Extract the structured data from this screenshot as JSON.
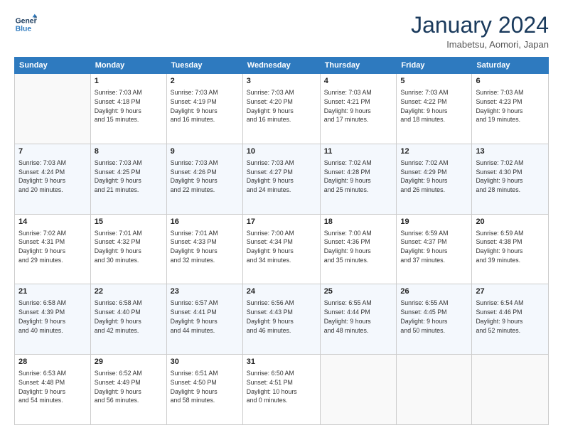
{
  "header": {
    "logo_line1": "General",
    "logo_line2": "Blue",
    "title": "January 2024",
    "subtitle": "Imabetsu, Aomori, Japan"
  },
  "weekdays": [
    "Sunday",
    "Monday",
    "Tuesday",
    "Wednesday",
    "Thursday",
    "Friday",
    "Saturday"
  ],
  "weeks": [
    [
      {
        "day": "",
        "info": ""
      },
      {
        "day": "1",
        "info": "Sunrise: 7:03 AM\nSunset: 4:18 PM\nDaylight: 9 hours\nand 15 minutes."
      },
      {
        "day": "2",
        "info": "Sunrise: 7:03 AM\nSunset: 4:19 PM\nDaylight: 9 hours\nand 16 minutes."
      },
      {
        "day": "3",
        "info": "Sunrise: 7:03 AM\nSunset: 4:20 PM\nDaylight: 9 hours\nand 16 minutes."
      },
      {
        "day": "4",
        "info": "Sunrise: 7:03 AM\nSunset: 4:21 PM\nDaylight: 9 hours\nand 17 minutes."
      },
      {
        "day": "5",
        "info": "Sunrise: 7:03 AM\nSunset: 4:22 PM\nDaylight: 9 hours\nand 18 minutes."
      },
      {
        "day": "6",
        "info": "Sunrise: 7:03 AM\nSunset: 4:23 PM\nDaylight: 9 hours\nand 19 minutes."
      }
    ],
    [
      {
        "day": "7",
        "info": ""
      },
      {
        "day": "8",
        "info": "Sunrise: 7:03 AM\nSunset: 4:25 PM\nDaylight: 9 hours\nand 21 minutes."
      },
      {
        "day": "9",
        "info": "Sunrise: 7:03 AM\nSunset: 4:26 PM\nDaylight: 9 hours\nand 22 minutes."
      },
      {
        "day": "10",
        "info": "Sunrise: 7:03 AM\nSunset: 4:27 PM\nDaylight: 9 hours\nand 24 minutes."
      },
      {
        "day": "11",
        "info": "Sunrise: 7:02 AM\nSunset: 4:28 PM\nDaylight: 9 hours\nand 25 minutes."
      },
      {
        "day": "12",
        "info": "Sunrise: 7:02 AM\nSunset: 4:29 PM\nDaylight: 9 hours\nand 26 minutes."
      },
      {
        "day": "13",
        "info": "Sunrise: 7:02 AM\nSunset: 4:30 PM\nDaylight: 9 hours\nand 28 minutes."
      }
    ],
    [
      {
        "day": "14",
        "info": ""
      },
      {
        "day": "15",
        "info": "Sunrise: 7:01 AM\nSunset: 4:32 PM\nDaylight: 9 hours\nand 30 minutes."
      },
      {
        "day": "16",
        "info": "Sunrise: 7:01 AM\nSunset: 4:33 PM\nDaylight: 9 hours\nand 32 minutes."
      },
      {
        "day": "17",
        "info": "Sunrise: 7:00 AM\nSunset: 4:34 PM\nDaylight: 9 hours\nand 34 minutes."
      },
      {
        "day": "18",
        "info": "Sunrise: 7:00 AM\nSunset: 4:36 PM\nDaylight: 9 hours\nand 35 minutes."
      },
      {
        "day": "19",
        "info": "Sunrise: 6:59 AM\nSunset: 4:37 PM\nDaylight: 9 hours\nand 37 minutes."
      },
      {
        "day": "20",
        "info": "Sunrise: 6:59 AM\nSunset: 4:38 PM\nDaylight: 9 hours\nand 39 minutes."
      }
    ],
    [
      {
        "day": "21",
        "info": ""
      },
      {
        "day": "22",
        "info": "Sunrise: 6:58 AM\nSunset: 4:40 PM\nDaylight: 9 hours\nand 42 minutes."
      },
      {
        "day": "23",
        "info": "Sunrise: 6:57 AM\nSunset: 4:41 PM\nDaylight: 9 hours\nand 44 minutes."
      },
      {
        "day": "24",
        "info": "Sunrise: 6:56 AM\nSunset: 4:43 PM\nDaylight: 9 hours\nand 46 minutes."
      },
      {
        "day": "25",
        "info": "Sunrise: 6:55 AM\nSunset: 4:44 PM\nDaylight: 9 hours\nand 48 minutes."
      },
      {
        "day": "26",
        "info": "Sunrise: 6:55 AM\nSunset: 4:45 PM\nDaylight: 9 hours\nand 50 minutes."
      },
      {
        "day": "27",
        "info": "Sunrise: 6:54 AM\nSunset: 4:46 PM\nDaylight: 9 hours\nand 52 minutes."
      }
    ],
    [
      {
        "day": "28",
        "info": ""
      },
      {
        "day": "29",
        "info": "Sunrise: 6:52 AM\nSunset: 4:49 PM\nDaylight: 9 hours\nand 56 minutes."
      },
      {
        "day": "30",
        "info": "Sunrise: 6:51 AM\nSunset: 4:50 PM\nDaylight: 9 hours\nand 58 minutes."
      },
      {
        "day": "31",
        "info": "Sunrise: 6:50 AM\nSunset: 4:51 PM\nDaylight: 10 hours\nand 0 minutes."
      },
      {
        "day": "",
        "info": ""
      },
      {
        "day": "",
        "info": ""
      },
      {
        "day": "",
        "info": ""
      }
    ]
  ],
  "week1_day7_info": "Sunrise: 7:03 AM\nSunset: 4:24 PM\nDaylight: 9 hours\nand 20 minutes.",
  "week2_day14_info": "Sunrise: 7:02 AM\nSunset: 4:31 PM\nDaylight: 9 hours\nand 29 minutes.",
  "week3_day21_info": "Sunrise: 6:58 AM\nSunset: 4:39 PM\nDaylight: 9 hours\nand 40 minutes.",
  "week4_day28_info": "Sunrise: 6:53 AM\nSunset: 4:48 PM\nDaylight: 9 hours\nand 54 minutes."
}
